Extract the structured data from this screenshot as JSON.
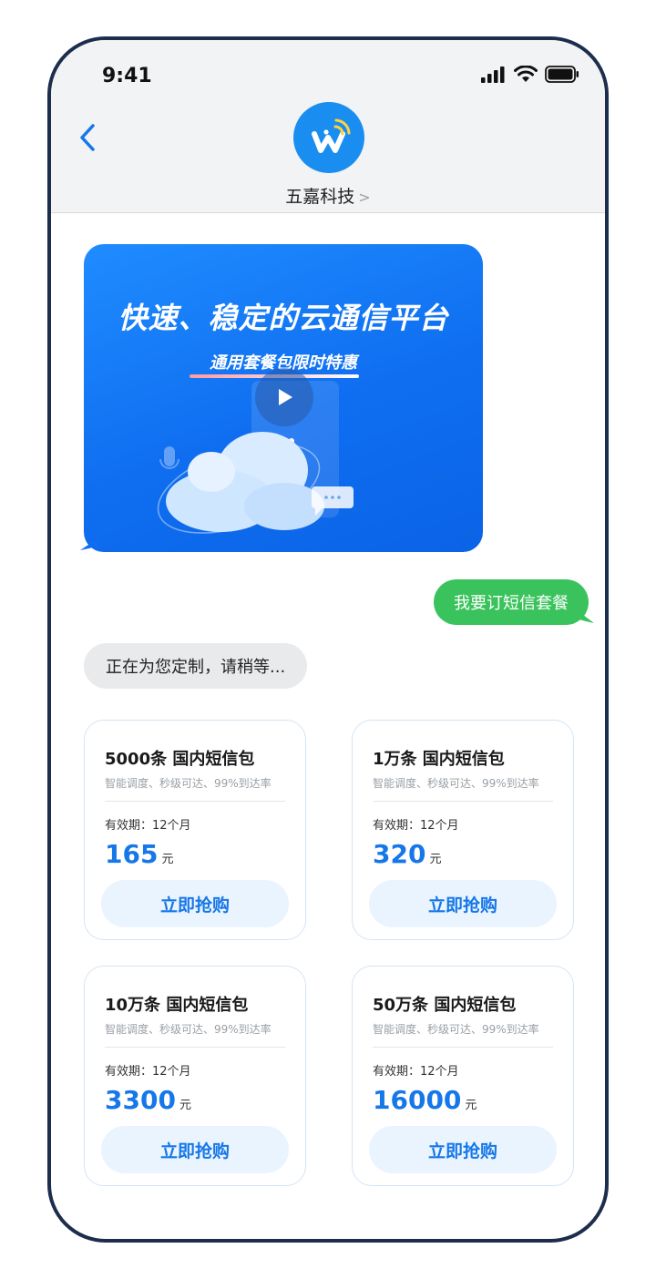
{
  "status_bar": {
    "time": "9:41"
  },
  "header": {
    "contact_name": "五嘉科技",
    "chevron": ">"
  },
  "banner": {
    "title": "快速、稳定的云通信平台",
    "subtitle": "通用套餐包限时特惠"
  },
  "messages": {
    "user_request": "我要订短信套餐",
    "bot_waiting": "正在为您定制，请稍等..."
  },
  "packages": [
    {
      "title": "5000条 国内短信包",
      "desc": "智能调度、秒级可达、99%到达率",
      "validity": "有效期：12个月",
      "price": "165",
      "unit": "元",
      "button": "立即抢购"
    },
    {
      "title": "1万条 国内短信包",
      "desc": "智能调度、秒级可达、99%到达率",
      "validity": "有效期：12个月",
      "price": "320",
      "unit": "元",
      "button": "立即抢购"
    },
    {
      "title": "10万条 国内短信包",
      "desc": "智能调度、秒级可达、99%到达率",
      "validity": "有效期：12个月",
      "price": "3300",
      "unit": "元",
      "button": "立即抢购"
    },
    {
      "title": "50万条 国内短信包",
      "desc": "智能调度、秒级可达、99%到达率",
      "validity": "有效期：12个月",
      "price": "16000",
      "unit": "元",
      "button": "立即抢购"
    }
  ],
  "colors": {
    "accent": "#1677e8",
    "user_bubble": "#3ac35c",
    "bot_bubble": "#e9eaeb",
    "frame": "#1c2d4d"
  },
  "icons": [
    "signal-icon",
    "wifi-icon",
    "battery-icon",
    "back-chevron-icon",
    "logo-icon",
    "play-icon"
  ]
}
